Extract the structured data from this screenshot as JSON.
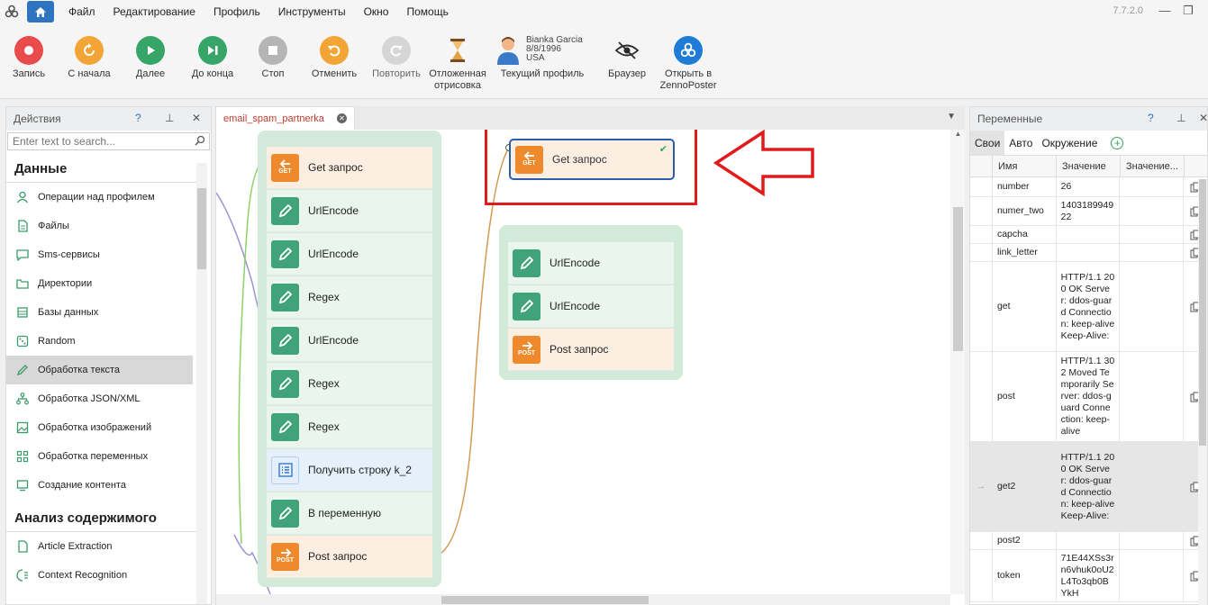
{
  "menu": {
    "items": [
      "Файл",
      "Редактирование",
      "Профиль",
      "Инструменты",
      "Окно",
      "Помощь"
    ],
    "version": "7.7.2.0"
  },
  "toolbar": {
    "record": "Запись",
    "from_start": "С начала",
    "next": "Далее",
    "to_end": "До конца",
    "stop": "Стоп",
    "undo": "Отменить",
    "redo": "Повторить",
    "deferred_line1": "Отложенная",
    "deferred_line2": "отрисовка",
    "profile_label": "Текущий профиль",
    "profile_name": "Bianka Garcia",
    "profile_date": "8/8/1996",
    "profile_country": "USA",
    "browser": "Браузер",
    "open_line1": "Открыть в",
    "open_line2": "ZennoPoster",
    "colors": {
      "record": "#e84b4b",
      "restart": "#f2a534",
      "next": "#36a567",
      "stop": "#b5b5b5",
      "undo": "#f2a534",
      "open": "#1f7bd6"
    }
  },
  "actions_panel": {
    "title": "Действия",
    "help": "?",
    "search_placeholder": "Enter text to search...",
    "section1": "Данные",
    "items": [
      "Операции над профилем",
      "Файлы",
      "Sms-сервисы",
      "Директории",
      "Базы данных",
      "Random",
      "Обработка текста",
      "Обработка JSON/XML",
      "Обработка изображений",
      "Обработка переменных",
      "Создание контента"
    ],
    "selected_index": 6,
    "section2": "Анализ содержимого",
    "items2": [
      "Article Extraction",
      "Context Recognition"
    ]
  },
  "canvas": {
    "tab_label": "email_spam_partnerka",
    "group1": [
      {
        "type": "orange",
        "icon": "get",
        "label": "Get запрос"
      },
      {
        "type": "green",
        "icon": "pen",
        "label": "UrlEncode"
      },
      {
        "type": "green",
        "icon": "pen",
        "label": "UrlEncode"
      },
      {
        "type": "green",
        "icon": "pen",
        "label": "Regex"
      },
      {
        "type": "green",
        "icon": "pen",
        "label": "UrlEncode"
      },
      {
        "type": "green",
        "icon": "pen",
        "label": "Regex"
      },
      {
        "type": "green",
        "icon": "pen",
        "label": "Regex"
      },
      {
        "type": "blue",
        "icon": "list",
        "label": "Получить строку k_2"
      },
      {
        "type": "green",
        "icon": "pen",
        "label": "В переменную"
      },
      {
        "type": "orange",
        "icon": "post",
        "label": "Post запрос"
      }
    ],
    "selected_block": "Get запрос",
    "group2": [
      {
        "type": "green",
        "icon": "pen",
        "label": "UrlEncode"
      },
      {
        "type": "green",
        "icon": "pen",
        "label": "UrlEncode"
      },
      {
        "type": "orange",
        "icon": "post",
        "label": "Post запрос"
      }
    ],
    "get_tag": "GET",
    "post_tag": "POST"
  },
  "variables_panel": {
    "title": "Переменные",
    "help": "?",
    "tabs": [
      "Свои",
      "Авто",
      "Окружение"
    ],
    "columns": [
      "Имя",
      "Значение",
      "Значение..."
    ],
    "rows": [
      {
        "name": "number",
        "value": "26"
      },
      {
        "name": "numer_two",
        "value": "140318994922"
      },
      {
        "name": "capcha",
        "value": ""
      },
      {
        "name": "link_letter",
        "value": ""
      },
      {
        "name": "get",
        "value": "HTTP/1.1 200 OK Server: ddos-guard Connection: keep-alive Keep-Alive:"
      },
      {
        "name": "post",
        "value": "HTTP/1.1 302 Moved Temporarily Server: ddos-guard Connection: keep-alive"
      },
      {
        "name": "get2",
        "value": "HTTP/1.1 200 OK Server: ddos-guard Connection: keep-alive Keep-Alive:"
      },
      {
        "name": "post2",
        "value": ""
      },
      {
        "name": "token",
        "value": "71E44XSs3rn6vhuk0oU2L4To3qb0BYkH"
      }
    ],
    "highlight_index": 6
  }
}
